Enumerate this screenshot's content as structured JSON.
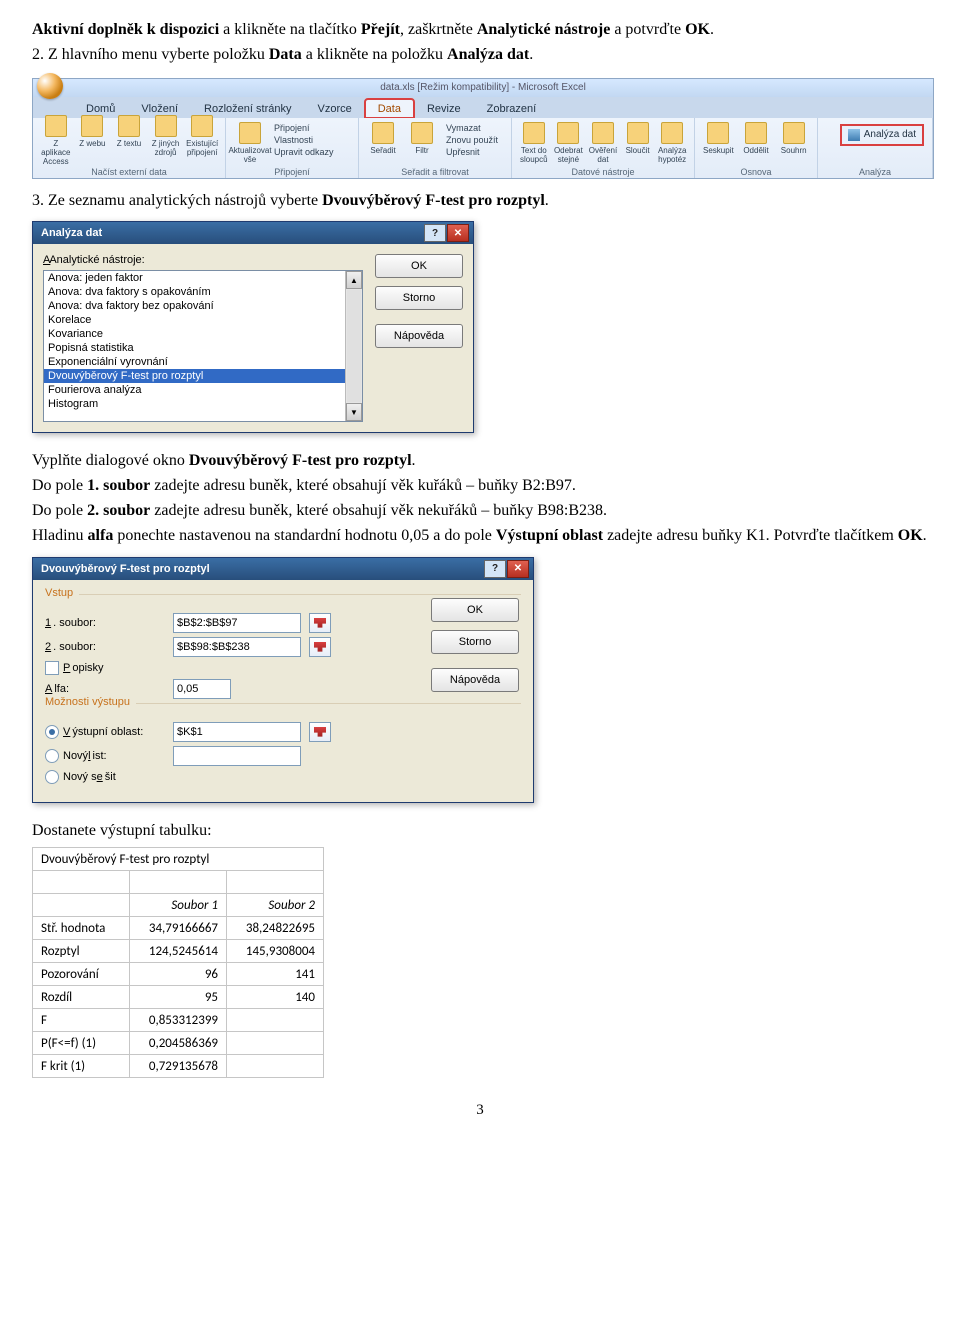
{
  "intro": {
    "line1_a": "Aktivní doplněk k dispozici",
    "line1_b": " a klikněte na tlačítko ",
    "line1_c": "Přejít",
    "line1_d": ", zaškrtněte ",
    "line1_e": "Analytické nástroje",
    "line1_f": " a potvrďte ",
    "line1_g": "OK",
    "line1_h": ".",
    "step2_a": "2. Z hlavního menu vyberte položku ",
    "step2_b": "Data",
    "step2_c": " a klikněte na položku ",
    "step2_d": "Analýza dat",
    "step2_e": "."
  },
  "ribbon": {
    "title": "data.xls  [Režim kompatibility] - Microsoft Excel",
    "tabs": [
      "Domů",
      "Vložení",
      "Rozložení stránky",
      "Vzorce",
      "Data",
      "Revize",
      "Zobrazení"
    ],
    "groups": {
      "g1": "Načíst externí data",
      "g2": "Připojení",
      "g3": "Seřadit a filtrovat",
      "g4": "Datové nástroje",
      "g5": "Osnova",
      "g6": "Analýza"
    },
    "buttons": {
      "b1": "Z aplikace Access",
      "b2": "Z webu",
      "b3": "Z textu",
      "b4": "Z jiných zdrojů",
      "b5": "Existující připojení",
      "b6": "Aktualizovat vše",
      "b7": "Připojení",
      "b8": "Vlastnosti",
      "b9": "Upravit odkazy",
      "b10": "Seřadit",
      "b11": "Filtr",
      "b12": "Vymazat",
      "b13": "Znovu použít",
      "b14": "Upřesnit",
      "b15": "Text do sloupců",
      "b16": "Odebrat stejné",
      "b17": "Ověření dat",
      "b18": "Sloučit",
      "b19": "Analýza hypotéz",
      "b20": "Seskupit",
      "b21": "Oddělit",
      "b22": "Souhrn",
      "analyza": "Analýza dat"
    }
  },
  "step3": {
    "a": "3. Ze seznamu analytických nástrojů vyberte ",
    "b": "Dvouvýběrový F-test pro rozptyl",
    "c": "."
  },
  "dlg1": {
    "title": "Analýza dat",
    "label": "Analytické nástroje:",
    "items": [
      "Anova: jeden faktor",
      "Anova: dva faktory s opakováním",
      "Anova: dva faktory bez opakování",
      "Korelace",
      "Kovariance",
      "Popisná statistika",
      "Exponenciální vyrovnání",
      "Dvouvýběrový F-test pro rozptyl",
      "Fourierova analýza",
      "Histogram"
    ],
    "ok": "OK",
    "storno": "Storno",
    "help": "Nápověda"
  },
  "midtext": {
    "l1a": "Vyplňte dialogové okno ",
    "l1b": "Dvouvýběrový F-test pro rozptyl",
    "l1c": ".",
    "l2a": "Do pole ",
    "l2b": "1. soubor",
    "l2c": " zadejte adresu buněk, které obsahují věk kuřáků – buňky B2:B97.",
    "l3a": "Do pole ",
    "l3b": "2. soubor",
    "l3c": " zadejte adresu buněk, které obsahují věk nekuřáků – buňky B98:B238.",
    "l4a": "Hladinu ",
    "l4b": "alfa",
    "l4c": " ponechte nastavenou na standardní hodnotu 0,05 a do pole ",
    "l4d": "Výstupní oblast",
    "l4e": " zadejte adresu buňky K1. Potvrďte tlačítkem ",
    "l4f": "OK",
    "l4g": "."
  },
  "dlg2": {
    "title": "Dvouvýběrový F-test pro rozptyl",
    "grp_vstup": "Vstup",
    "lbl1": ". soubor:",
    "lbl2": ". soubor:",
    "one": "1",
    "two": "2",
    "val1": "$B$2:$B$97",
    "val2": "$B$98:$B$238",
    "popisky": "opisky",
    "popisky_u": "P",
    "alfa": "lfa:",
    "alfa_u": "A",
    "alfa_val": "0,05",
    "grp_out": "Možnosti výstupu",
    "out1": "ýstupní oblast:",
    "out1_u": "V",
    "out1_val": "$K$1",
    "out2": "Nový ",
    "out2b": "ist:",
    "out2_u": "l",
    "out3": "Nový s",
    "out3b": "šit",
    "out3_u": "e",
    "ok": "OK",
    "storno": "Storno",
    "help": "Nápověda"
  },
  "outtext": "Dostanete výstupní tabulku:",
  "chart_data": {
    "type": "table",
    "title": "Dvouvýběrový F-test pro rozptyl",
    "columns": [
      "",
      "Soubor 1",
      "Soubor 2"
    ],
    "rows": [
      {
        "label": "Stř. hodnota",
        "v1": "34,79166667",
        "v2": "38,24822695"
      },
      {
        "label": "Rozptyl",
        "v1": "124,5245614",
        "v2": "145,9308004"
      },
      {
        "label": "Pozorování",
        "v1": "96",
        "v2": "141"
      },
      {
        "label": "Rozdíl",
        "v1": "95",
        "v2": "140"
      },
      {
        "label": "F",
        "v1": "0,853312399",
        "v2": ""
      },
      {
        "label": "P(F<=f) (1)",
        "v1": "0,204586369",
        "v2": ""
      },
      {
        "label": "F krit (1)",
        "v1": "0,729135678",
        "v2": ""
      }
    ]
  },
  "page_number": "3"
}
